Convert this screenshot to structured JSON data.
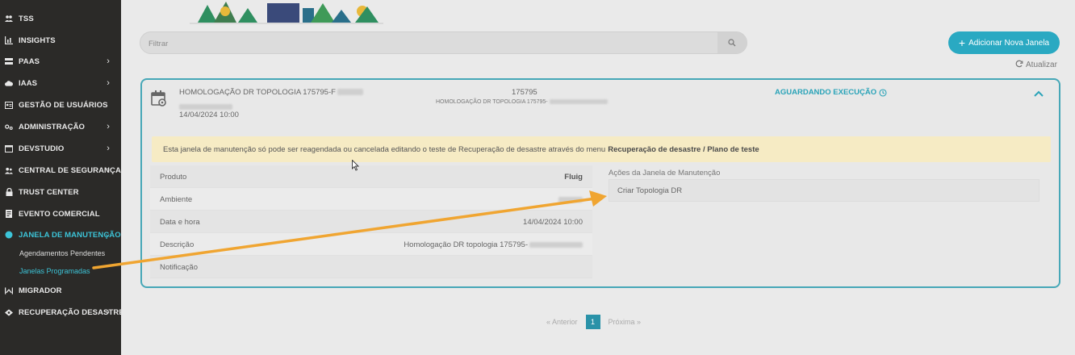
{
  "sidebar": {
    "items": [
      {
        "label": "TSS",
        "icon": "people-group-icon",
        "chevron": ""
      },
      {
        "label": "INSIGHTS",
        "icon": "bar-chart-icon",
        "chevron": ""
      },
      {
        "label": "PAAS",
        "icon": "server-icon",
        "chevron": "›"
      },
      {
        "label": "IAAS",
        "icon": "cloud-icon",
        "chevron": "›"
      },
      {
        "label": "GESTÃO DE USUÁRIOS",
        "icon": "id-card-icon",
        "chevron": ""
      },
      {
        "label": "ADMINISTRAÇÃO",
        "icon": "gears-icon",
        "chevron": "›"
      },
      {
        "label": "DEVSTUDIO",
        "icon": "code-window-icon",
        "chevron": "›"
      },
      {
        "label": "CENTRAL DE SEGURANÇA",
        "icon": "users-icon",
        "chevron": "›"
      },
      {
        "label": "TRUST CENTER",
        "icon": "lock-icon",
        "chevron": ""
      },
      {
        "label": "EVENTO COMERCIAL",
        "icon": "document-icon",
        "chevron": ""
      },
      {
        "label": "JANELA DE MANUTENÇÃO",
        "icon": "circle-icon",
        "chevron": "⌄"
      },
      {
        "label": "MIGRADOR",
        "icon": "migrate-icon",
        "chevron": ""
      },
      {
        "label": "RECUPERAÇÃO DESASTRE",
        "icon": "recovery-icon",
        "chevron": "›"
      }
    ],
    "subitems": [
      {
        "label": "Agendamentos Pendentes"
      },
      {
        "label": "Janelas Programadas"
      }
    ]
  },
  "filter": {
    "placeholder": "Filtrar"
  },
  "toolbar": {
    "add_label": "Adicionar Nova Janela",
    "refresh_label": "Atualizar"
  },
  "card": {
    "title": "HOMOLOGAÇÃO DR TOPOLOGIA 175795-F",
    "date": "14/04/2024 10:00",
    "id": "175795",
    "id_sub": "HOMOLOGAÇÃO DR TOPOLOGIA 175795-",
    "status": "AGUARDANDO EXECUÇÃO",
    "warning_text": "Esta janela de manutenção só pode ser reagendada ou cancelada editando o teste de Recuperação de desastre através do menu",
    "warning_bold": "Recuperação de desastre / Plano de teste",
    "details": [
      {
        "label": "Produto",
        "value": "Fluig"
      },
      {
        "label": "Ambiente",
        "value": ""
      },
      {
        "label": "Data e hora",
        "value": "14/04/2024 10:00"
      },
      {
        "label": "Descrição",
        "value": "Homologação DR topologia 175795-"
      },
      {
        "label": "Notificação",
        "value": ""
      }
    ],
    "actions_title": "Ações da Janela de Manutenção",
    "actions": [
      {
        "label": "Criar Topologia DR"
      }
    ]
  },
  "pagination": {
    "prev": "« Anterior",
    "current": "1",
    "next": "Próxima »"
  },
  "colors": {
    "accent": "#2aa9c2",
    "sidebar_bg": "#2b2a28",
    "active": "#3cc4d8",
    "warning_bg": "#f6ebc4",
    "annotation_arrow": "#f0a531"
  }
}
